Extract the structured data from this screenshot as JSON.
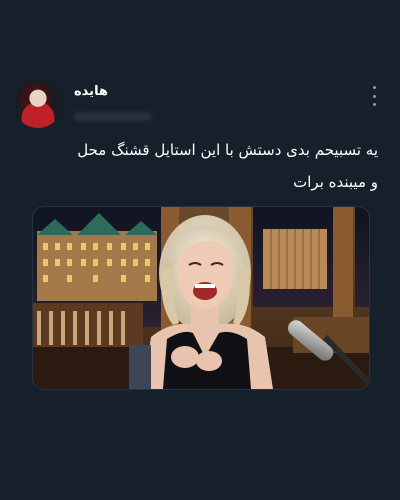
{
  "tweet": {
    "display_name": "هایده",
    "text": "یه تسبیحم بدی دستش با این استایل قشنگ محل\nو میبنده برات"
  },
  "icons": {
    "more": "more-vertical-icon"
  },
  "colors": {
    "background": "#16202b",
    "text_primary": "#ffffff",
    "icon_muted": "#8b98a5"
  }
}
